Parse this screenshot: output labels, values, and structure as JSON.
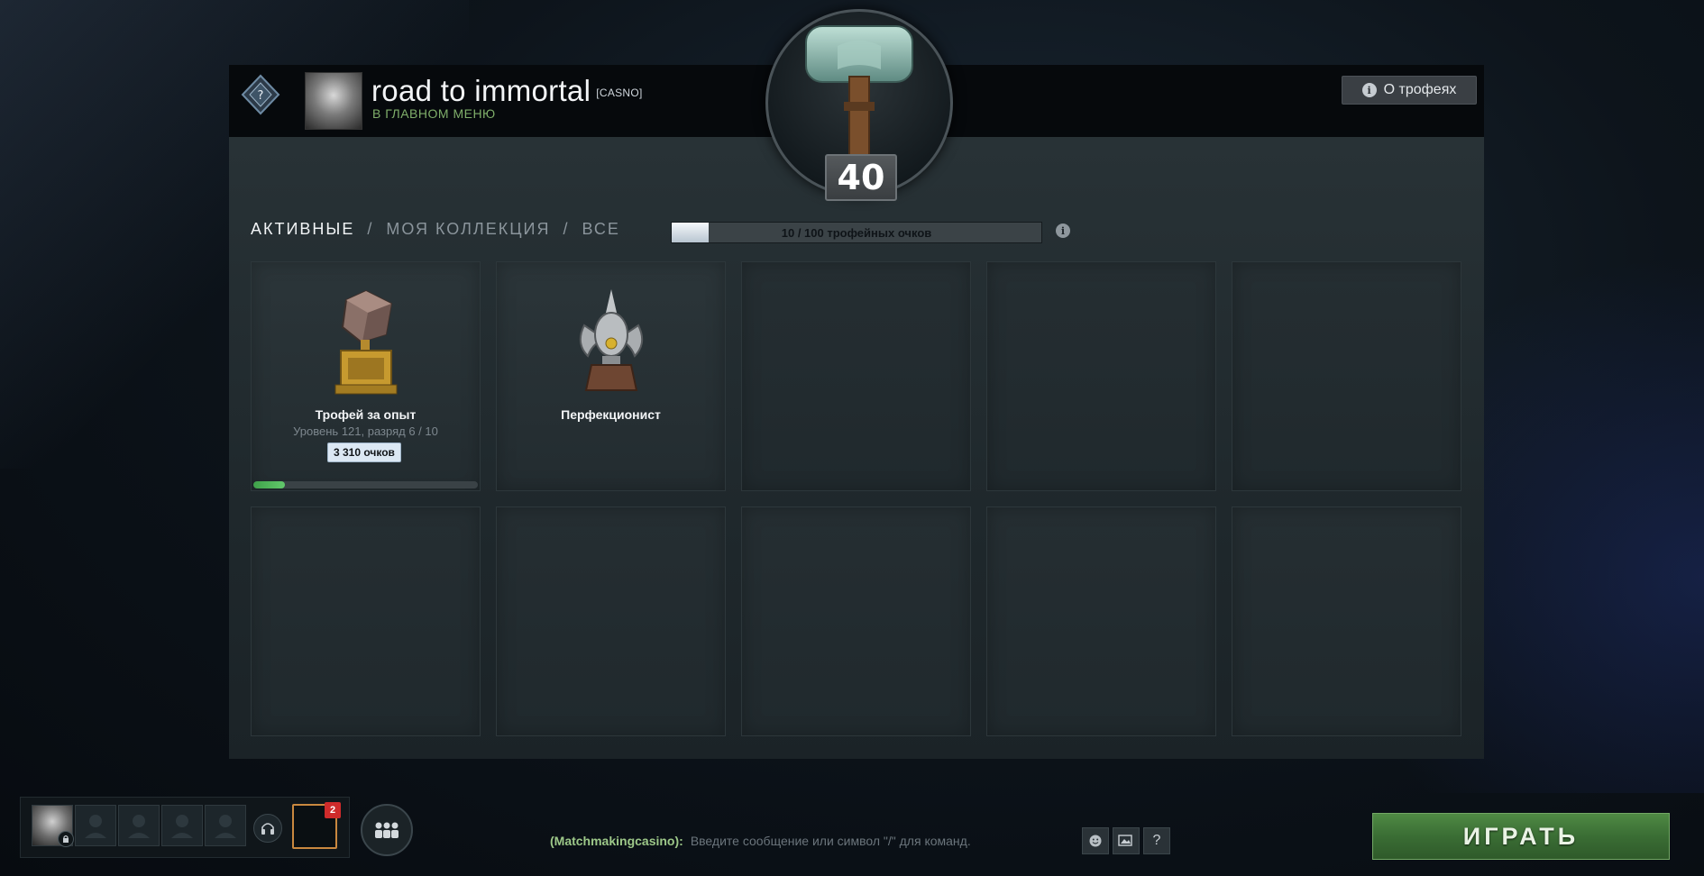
{
  "profile": {
    "name": "road to immortal",
    "tag": "[CASNO]",
    "status": "В ГЛАВНОМ МЕНЮ",
    "about_button": "О трофеях"
  },
  "level": {
    "value": "40"
  },
  "tabs": [
    {
      "label": "АКТИВНЫЕ",
      "active": true
    },
    {
      "label": "МОЯ КОЛЛЕКЦИЯ",
      "active": false
    },
    {
      "label": "ВСЕ",
      "active": false
    }
  ],
  "tab_separator": "/",
  "trophy_points": {
    "text": "10 / 100 трофейных очков",
    "current": 10,
    "max": 100,
    "info_icon": "info-icon"
  },
  "trophies": [
    {
      "name": "Трофей за опыт",
      "subtitle": "Уровень 121, разряд 6 / 10",
      "points": "3 310 очков",
      "progress": 0.14,
      "icon": "experience-trophy-icon"
    },
    {
      "name": "Перфекционист",
      "icon": "perfectionist-trophy-icon"
    }
  ],
  "bottom_bar": {
    "notification_count": "2",
    "chat_channel": "(Matchmakingcasino):",
    "chat_placeholder": "Введите сообщение или символ \"/\" для команд.",
    "help_label": "?",
    "play_button": "ИГРАТЬ"
  },
  "colors": {
    "accent_green": "#3a6d34",
    "status_green": "#7fae6a",
    "notification_red": "#cf2b2b"
  }
}
